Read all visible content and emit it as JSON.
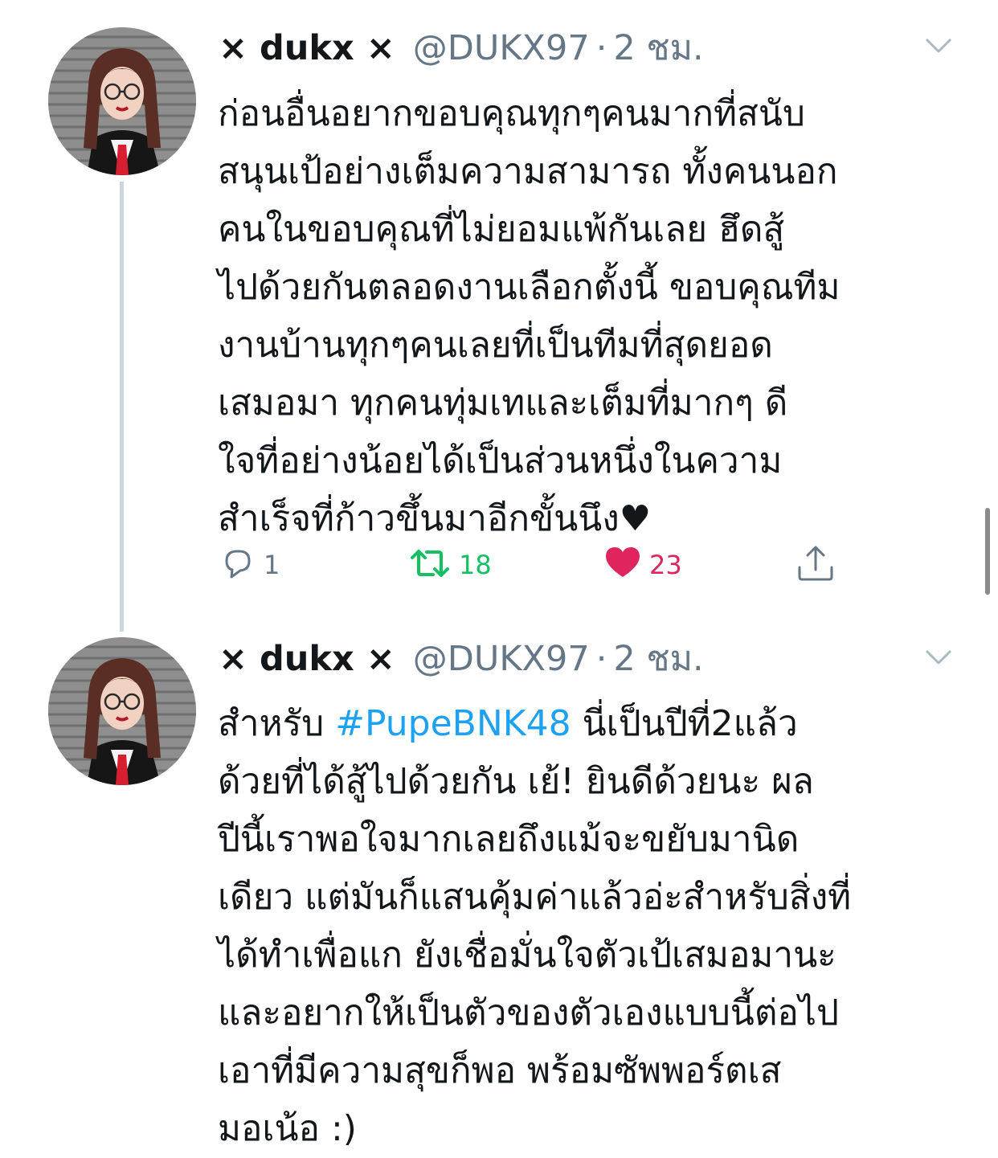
{
  "colors": {
    "text": "#14171a",
    "secondary": "#657786",
    "link": "#1da1f2",
    "retweet": "#17bf63",
    "like": "#e0245e",
    "thread_line": "#ccd6dd"
  },
  "tweets": [
    {
      "display_name": "× dukx ×",
      "handle": "@DUKX97",
      "separator": "·",
      "time": "2 ชม.",
      "text_lines": [
        "ก่อนอื่นอยากขอบคุณทุกๆคนมากที่สนับ",
        "สนุนเป้อย่างเต็มความสามารถ ทั้งคนนอก",
        "คนในขอบคุณที่ไม่ยอมแพ้กันเลย ฮึดสู้",
        "ไปด้วยกันตลอดงานเลือกตั้งนี้ ขอบคุณทีม",
        "งานบ้านทุกๆคนเลยที่เป็นทีมที่สุดยอด",
        "เสมอมา ทุกคนทุ่มเทและเต็มที่มากๆ ดี",
        "ใจที่อย่างน้อยได้เป็นส่วนหนึ่งในความ",
        "สำเร็จที่ก้าวขึ้นมาอีกขั้นนึง♥"
      ],
      "actions": {
        "reply_count": "1",
        "retweet_count": "18",
        "like_count": "23",
        "reply_icon": "reply-icon",
        "retweet_icon": "retweet-icon",
        "like_icon": "heart-icon",
        "share_icon": "share-icon"
      }
    },
    {
      "display_name": "× dukx ×",
      "handle": "@DUKX97",
      "separator": "·",
      "time": "2 ชม.",
      "line1_before": "สำหรับ ",
      "hashtag": "#PupeBNK48",
      "line1_after": " นี่เป็นปีที่2แล้ว",
      "text_lines": [
        "ด้วยที่ได้สู้ไปด้วยกัน เย้! ยินดีด้วยนะ ผล",
        "ปีนี้เราพอใจมากเลยถึงแม้จะขยับมานิด",
        "เดียว แต่มันก็แสนคุ้มค่าแล้วอ่ะสำหรับสิ่งที่",
        "ได้ทำเพื่อแก ยังเชื่อมั่นใจตัวเป้เสมอมานะ",
        "และอยากให้เป็นตัวของตัวเองแบบนี้ต่อไป",
        "เอาที่มีความสุขก็พอ พร้อมซัพพอร์ตเส",
        "มอเน้อ :)"
      ]
    }
  ]
}
